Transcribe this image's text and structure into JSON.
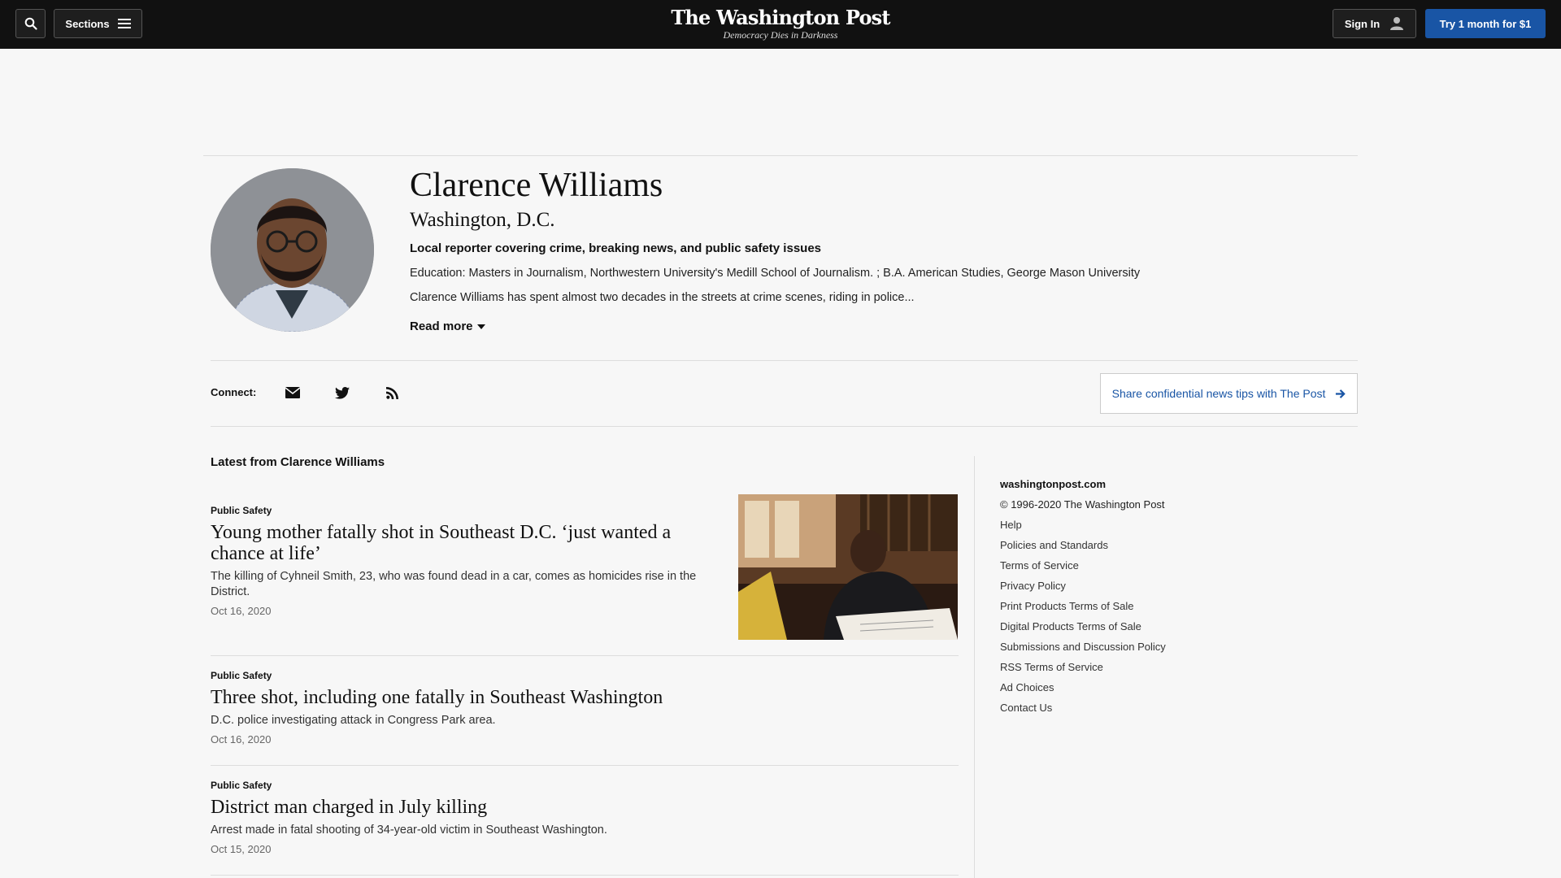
{
  "header": {
    "sections_label": "Sections",
    "masthead_title": "The Washington Post",
    "masthead_tagline": "Democracy Dies in Darkness",
    "sign_in_label": "Sign In",
    "trial_label": "Try 1 month for $1",
    "accent_color": "#1955a5"
  },
  "profile": {
    "name": "Clarence Williams",
    "location": "Washington, D.C.",
    "role": "Local reporter covering crime, breaking news, and public safety issues",
    "education": "Education: Masters in Journalism, Northwestern University's Medill School of Journalism. ; B.A. American Studies, George Mason University",
    "bio_excerpt": "Clarence Williams has spent almost two decades in the streets at crime scenes, riding in police...",
    "read_more_label": "Read more"
  },
  "connect": {
    "label": "Connect:",
    "icons": [
      "email-icon",
      "twitter-icon",
      "rss-icon"
    ],
    "tips_label": "Share confidential news tips with The Post"
  },
  "latest": {
    "title": "Latest from Clarence Williams",
    "stories": [
      {
        "kicker": "Public Safety",
        "headline": "Young mother fatally shot in Southeast D.C. ‘just wanted a chance at life’",
        "blurb": "The killing of Cyhneil Smith, 23, who was found dead in a car, comes as homicides rise in the District.",
        "date": "Oct 16, 2020"
      },
      {
        "kicker": "Public Safety",
        "headline": "Three shot, including one fatally in Southeast Washington",
        "blurb": "D.C. police investigating attack in Congress Park area.",
        "date": "Oct 16, 2020"
      },
      {
        "kicker": "Public Safety",
        "headline": "District man charged in July killing",
        "blurb": "Arrest made in fatal shooting of 34-year-old victim in Southeast Washington.",
        "date": "Oct 15, 2020"
      }
    ]
  },
  "sidebar": {
    "domain": "washingtonpost.com",
    "copyright": "© 1996-2020 The Washington Post",
    "links": [
      "Help",
      "Policies and Standards",
      "Terms of Service",
      "Privacy Policy",
      "Print Products Terms of Sale",
      "Digital Products Terms of Sale",
      "Submissions and Discussion Policy",
      "RSS Terms of Service",
      "Ad Choices",
      "Contact Us"
    ]
  }
}
